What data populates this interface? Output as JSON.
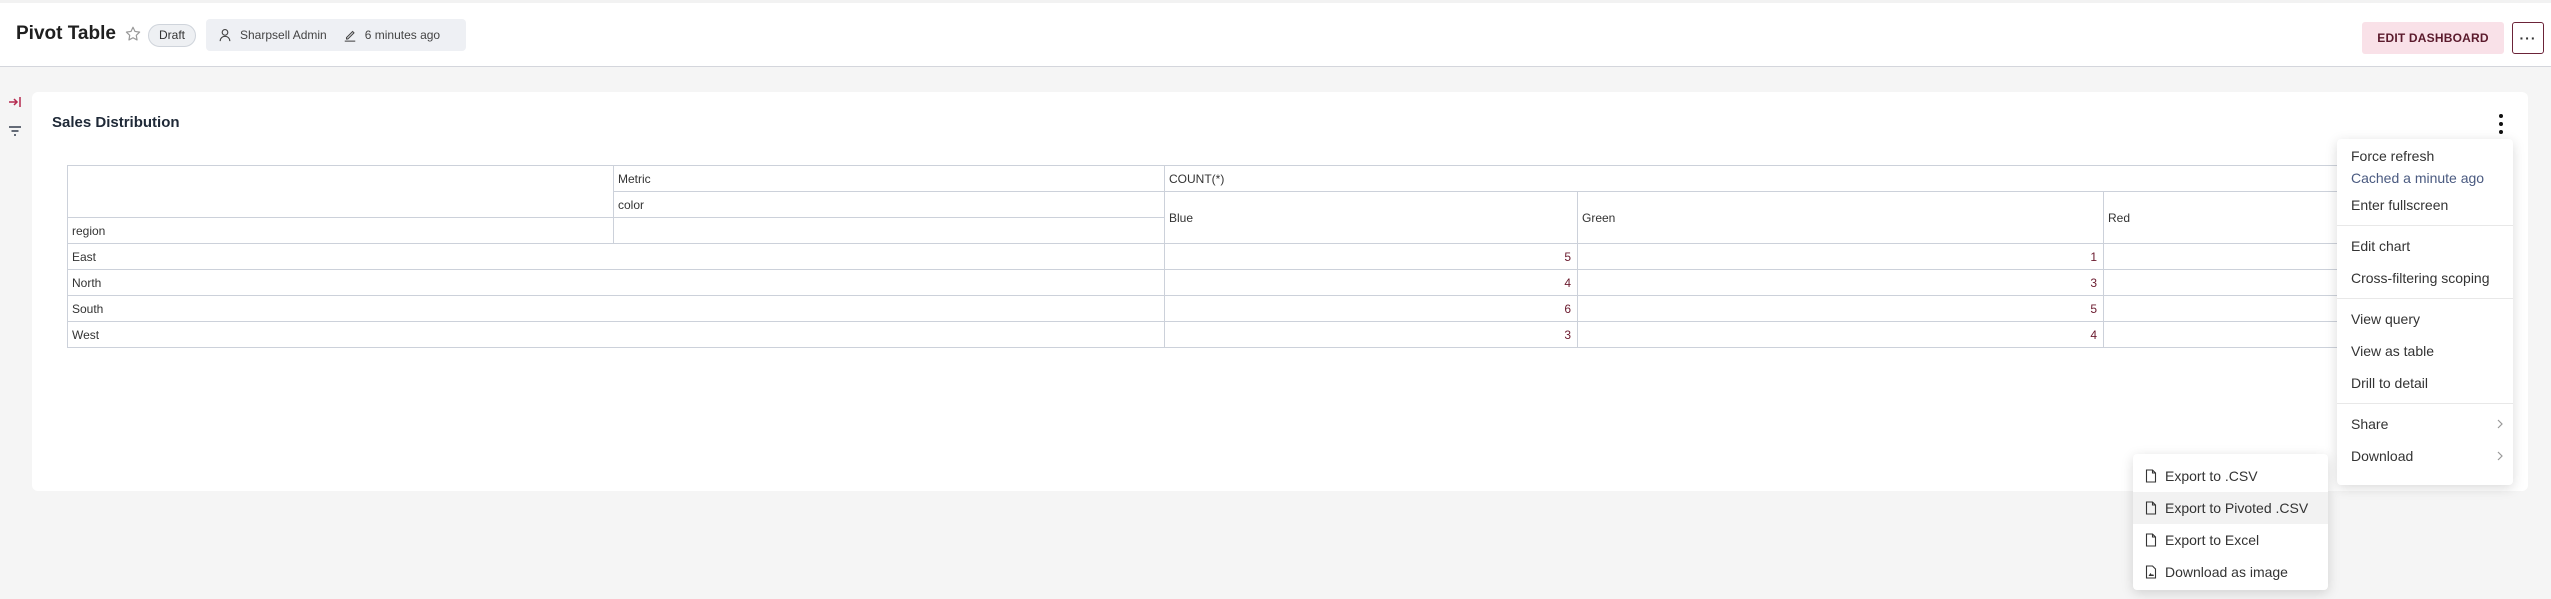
{
  "header": {
    "title": "Pivot Table",
    "status_badge": "Draft",
    "owner": "Sharpsell Admin",
    "modified": "6 minutes ago",
    "edit_button": "EDIT DASHBOARD",
    "more_button": "···",
    "accent_color": "#f9e1e8",
    "accent_text_color": "#5b1a2c"
  },
  "chart": {
    "title": "Sales Distribution",
    "pivot": {
      "metric_label": "Metric",
      "metric_value": "COUNT(*)",
      "column_field": "color",
      "row_field": "region",
      "columns": [
        "Blue",
        "Green",
        "Red"
      ],
      "rows": [
        {
          "label": "East",
          "values": [
            "5",
            "1",
            ""
          ]
        },
        {
          "label": "North",
          "values": [
            "4",
            "3",
            ""
          ]
        },
        {
          "label": "South",
          "values": [
            "6",
            "5",
            ""
          ]
        },
        {
          "label": "West",
          "values": [
            "3",
            "4",
            ""
          ]
        }
      ]
    }
  },
  "menu": {
    "items": [
      {
        "label": "Force refresh"
      },
      {
        "label": "Cached a minute ago"
      },
      {
        "label": "Enter fullscreen"
      },
      {
        "label": "Edit chart"
      },
      {
        "label": "Cross-filtering scoping"
      },
      {
        "label": "View query"
      },
      {
        "label": "View as table"
      },
      {
        "label": "Drill to detail"
      },
      {
        "label": "Share"
      },
      {
        "label": "Download"
      }
    ]
  },
  "download_submenu": {
    "items": [
      {
        "label": "Export to .CSV"
      },
      {
        "label": "Export to Pivoted .CSV"
      },
      {
        "label": "Export to Excel"
      },
      {
        "label": "Download as image"
      }
    ]
  }
}
